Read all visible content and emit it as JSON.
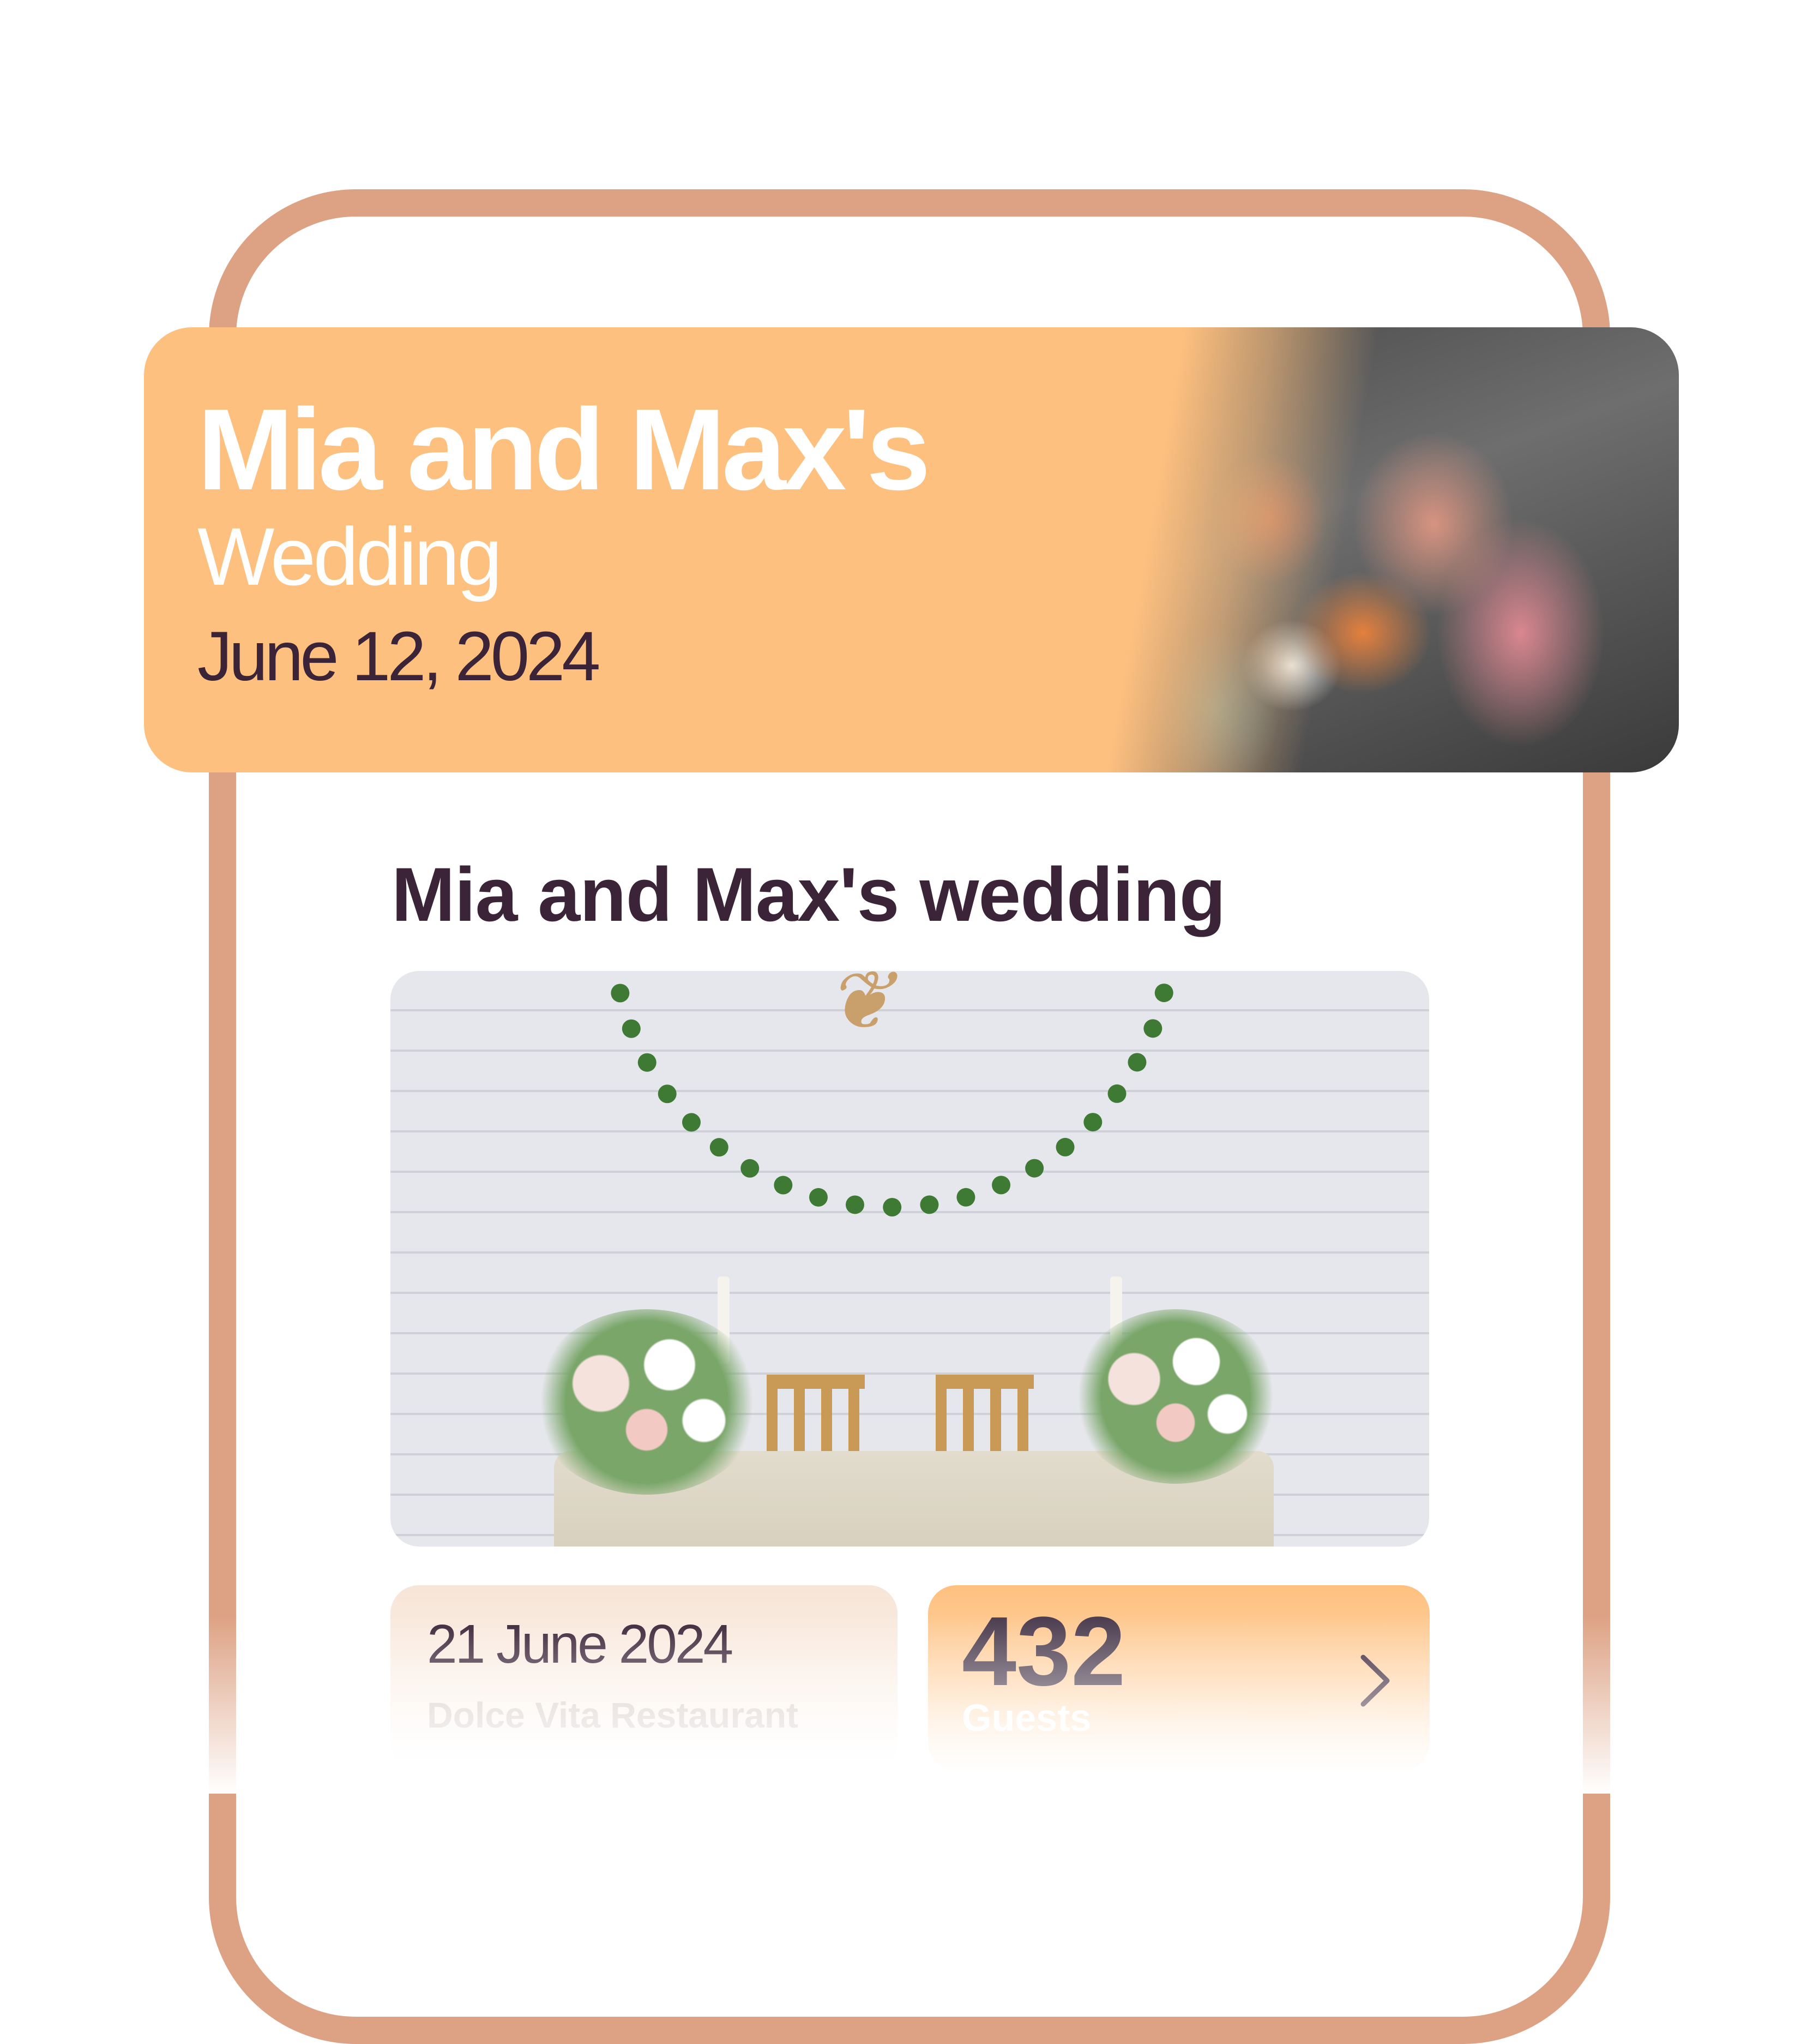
{
  "banner": {
    "title": "Mia and Max's",
    "subtitle": "Wedding",
    "date": "June 12, 2024",
    "photo_alt": "couple-photo"
  },
  "main": {
    "title": "Mia and Max's wedding",
    "photo_alt": "venue-photo"
  },
  "cards": {
    "date": {
      "value": "21 June 2024",
      "venue": "Dolce Vita Restaurant"
    },
    "guests": {
      "count": "432",
      "label": "Guests",
      "icon": "chevron-right-icon"
    }
  },
  "colors": {
    "accent": "#fec07f",
    "frame": "#dda183",
    "text_dark": "#3b2438"
  }
}
